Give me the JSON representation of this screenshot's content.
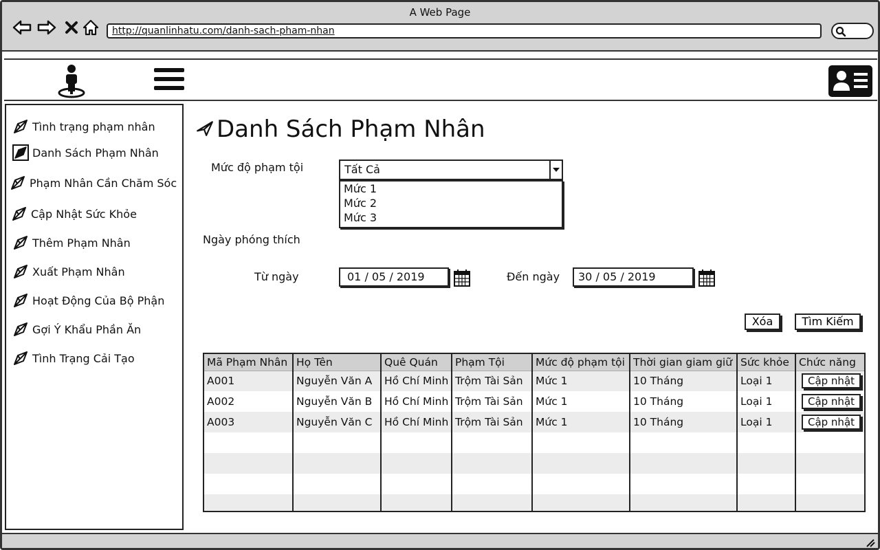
{
  "window": {
    "title": "A Web Page",
    "url": "http://quanlinhatu.com/danh-sach-pham-nhan"
  },
  "sidebar": {
    "items": [
      {
        "label": "Tình trạng phạm nhân"
      },
      {
        "label": "Danh Sách Phạm Nhân"
      },
      {
        "label": "Phạm Nhân Cần Chăm Sóc"
      },
      {
        "label": "Cập Nhật Sức Khỏe"
      },
      {
        "label": "Thêm Phạm Nhân"
      },
      {
        "label": "Xuất Phạm Nhân"
      },
      {
        "label": "Hoạt Động Của Bộ Phận"
      },
      {
        "label": "Gợi Ý Khẩu Phần Ăn"
      },
      {
        "label": "Tình Trạng Cải Tạo"
      }
    ]
  },
  "page": {
    "title": "Danh Sách Phạm Nhân"
  },
  "filters": {
    "severity_label": "Mức độ phạm tội",
    "severity_selected": "Tất Cả",
    "severity_options": [
      "Mức 1",
      "Mức 2",
      "Mức 3"
    ],
    "release_label": "Ngày phóng thích",
    "from_label": "Từ ngày",
    "from_value": "01 / 05 / 2019",
    "to_label": "Đến ngày",
    "to_value": "30  / 05 / 2019",
    "clear_label": "Xóa",
    "search_label": "Tìm Kiếm"
  },
  "table": {
    "headers": [
      "Mã Phạm Nhân",
      "Họ Tên",
      "Quê Quán",
      "Phạm Tội",
      "Mức độ phạm tội",
      "Thời gian giam giữ",
      "Sức khỏe",
      "Chức năng"
    ],
    "rows": [
      {
        "id": "A001",
        "name": "Nguyễn Văn A",
        "hometown": "Hồ Chí Minh",
        "crime": "Trộm Tài Sản",
        "level": "Mức 1",
        "duration": "10 Tháng",
        "health": "Loại 1",
        "action": "Cập nhật"
      },
      {
        "id": "A002",
        "name": "Nguyễn Văn B",
        "hometown": "Hồ Chí Minh",
        "crime": "Trộm Tài Sản",
        "level": "Mức 1",
        "duration": "10 Tháng",
        "health": "Loại 1",
        "action": "Cập nhật"
      },
      {
        "id": "A003",
        "name": "Nguyễn Văn C",
        "hometown": "Hồ Chí Minh",
        "crime": "Trộm Tài Sản",
        "level": "Mức 1",
        "duration": "10 Tháng",
        "health": "Loại 1",
        "action": "Cập nhật"
      }
    ]
  },
  "icons": {
    "back": "arrow-left-icon",
    "forward": "arrow-right-icon",
    "stop": "close-icon",
    "home": "home-icon",
    "search": "search-icon",
    "logo": "person-pin-icon",
    "menu": "hamburger-menu-icon",
    "profile": "id-card-icon",
    "nav": "paper-plane-icon",
    "calendar": "calendar-icon"
  }
}
